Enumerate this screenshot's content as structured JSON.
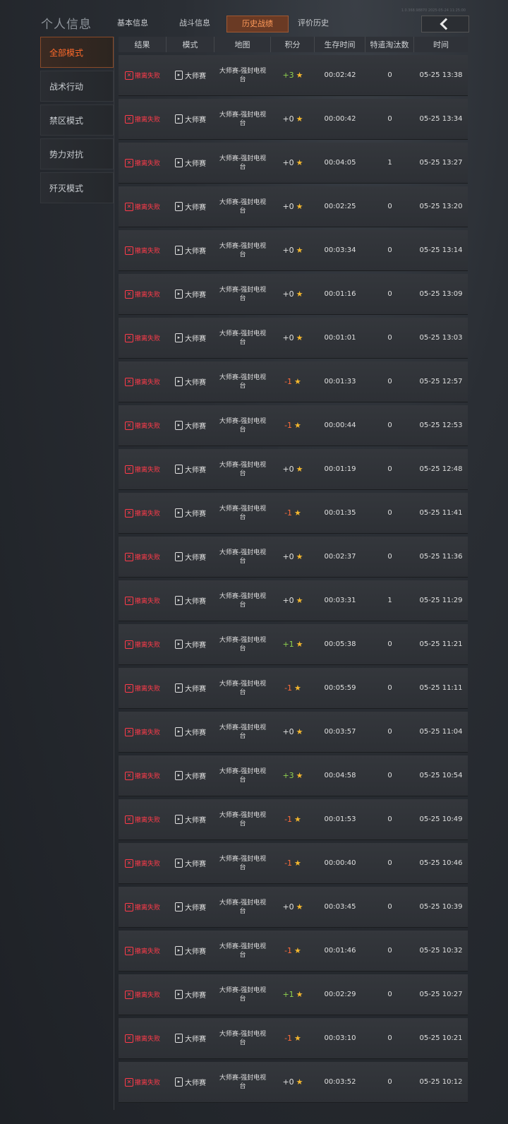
{
  "header": {
    "title": "个人信息",
    "tabs": [
      "基本信息",
      "战斗信息",
      "历史战绩",
      "评价历史"
    ],
    "active_tab": 2,
    "version": "1.0.368.98870 2025-05-24 11:25:00"
  },
  "sidebar": {
    "items": [
      "全部模式",
      "战术行动",
      "禁区模式",
      "势力对抗",
      "歼灭模式"
    ],
    "active": 0
  },
  "table": {
    "headers": [
      "结果",
      "模式",
      "地图",
      "积分",
      "生存时间",
      "特遣淘汰数",
      "时间"
    ],
    "rows": [
      {
        "result": "撤离失败",
        "mode": "大师赛",
        "map": "大师赛-强封电视台",
        "score": "+3",
        "survive": "00:02:42",
        "kills": "0",
        "time": "05-25 13:38"
      },
      {
        "result": "撤离失败",
        "mode": "大师赛",
        "map": "大师赛-强封电视台",
        "score": "+0",
        "survive": "00:00:42",
        "kills": "0",
        "time": "05-25 13:34"
      },
      {
        "result": "撤离失败",
        "mode": "大师赛",
        "map": "大师赛-强封电视台",
        "score": "+0",
        "survive": "00:04:05",
        "kills": "1",
        "time": "05-25 13:27"
      },
      {
        "result": "撤离失败",
        "mode": "大师赛",
        "map": "大师赛-强封电视台",
        "score": "+0",
        "survive": "00:02:25",
        "kills": "0",
        "time": "05-25 13:20"
      },
      {
        "result": "撤离失败",
        "mode": "大师赛",
        "map": "大师赛-强封电视台",
        "score": "+0",
        "survive": "00:03:34",
        "kills": "0",
        "time": "05-25 13:14"
      },
      {
        "result": "撤离失败",
        "mode": "大师赛",
        "map": "大师赛-强封电视台",
        "score": "+0",
        "survive": "00:01:16",
        "kills": "0",
        "time": "05-25 13:09"
      },
      {
        "result": "撤离失败",
        "mode": "大师赛",
        "map": "大师赛-强封电视台",
        "score": "+0",
        "survive": "00:01:01",
        "kills": "0",
        "time": "05-25 13:03"
      },
      {
        "result": "撤离失败",
        "mode": "大师赛",
        "map": "大师赛-强封电视台",
        "score": "-1",
        "survive": "00:01:33",
        "kills": "0",
        "time": "05-25 12:57"
      },
      {
        "result": "撤离失败",
        "mode": "大师赛",
        "map": "大师赛-强封电视台",
        "score": "-1",
        "survive": "00:00:44",
        "kills": "0",
        "time": "05-25 12:53"
      },
      {
        "result": "撤离失败",
        "mode": "大师赛",
        "map": "大师赛-强封电视台",
        "score": "+0",
        "survive": "00:01:19",
        "kills": "0",
        "time": "05-25 12:48"
      },
      {
        "result": "撤离失败",
        "mode": "大师赛",
        "map": "大师赛-强封电视台",
        "score": "-1",
        "survive": "00:01:35",
        "kills": "0",
        "time": "05-25 11:41"
      },
      {
        "result": "撤离失败",
        "mode": "大师赛",
        "map": "大师赛-强封电视台",
        "score": "+0",
        "survive": "00:02:37",
        "kills": "0",
        "time": "05-25 11:36"
      },
      {
        "result": "撤离失败",
        "mode": "大师赛",
        "map": "大师赛-强封电视台",
        "score": "+0",
        "survive": "00:03:31",
        "kills": "1",
        "time": "05-25 11:29"
      },
      {
        "result": "撤离失败",
        "mode": "大师赛",
        "map": "大师赛-强封电视台",
        "score": "+1",
        "survive": "00:05:38",
        "kills": "0",
        "time": "05-25 11:21"
      },
      {
        "result": "撤离失败",
        "mode": "大师赛",
        "map": "大师赛-强封电视台",
        "score": "-1",
        "survive": "00:05:59",
        "kills": "0",
        "time": "05-25 11:11"
      },
      {
        "result": "撤离失败",
        "mode": "大师赛",
        "map": "大师赛-强封电视台",
        "score": "+0",
        "survive": "00:03:57",
        "kills": "0",
        "time": "05-25 11:04"
      },
      {
        "result": "撤离失败",
        "mode": "大师赛",
        "map": "大师赛-强封电视台",
        "score": "+3",
        "survive": "00:04:58",
        "kills": "0",
        "time": "05-25 10:54"
      },
      {
        "result": "撤离失败",
        "mode": "大师赛",
        "map": "大师赛-强封电视台",
        "score": "-1",
        "survive": "00:01:53",
        "kills": "0",
        "time": "05-25 10:49"
      },
      {
        "result": "撤离失败",
        "mode": "大师赛",
        "map": "大师赛-强封电视台",
        "score": "-1",
        "survive": "00:00:40",
        "kills": "0",
        "time": "05-25 10:46"
      },
      {
        "result": "撤离失败",
        "mode": "大师赛",
        "map": "大师赛-强封电视台",
        "score": "+0",
        "survive": "00:03:45",
        "kills": "0",
        "time": "05-25 10:39"
      },
      {
        "result": "撤离失败",
        "mode": "大师赛",
        "map": "大师赛-强封电视台",
        "score": "-1",
        "survive": "00:01:46",
        "kills": "0",
        "time": "05-25 10:32"
      },
      {
        "result": "撤离失败",
        "mode": "大师赛",
        "map": "大师赛-强封电视台",
        "score": "+1",
        "survive": "00:02:29",
        "kills": "0",
        "time": "05-25 10:27"
      },
      {
        "result": "撤离失败",
        "mode": "大师赛",
        "map": "大师赛-强封电视台",
        "score": "-1",
        "survive": "00:03:10",
        "kills": "0",
        "time": "05-25 10:21"
      },
      {
        "result": "撤离失败",
        "mode": "大师赛",
        "map": "大师赛-强封电视台",
        "score": "+0",
        "survive": "00:03:52",
        "kills": "0",
        "time": "05-25 10:12"
      }
    ]
  },
  "colors": {
    "accent": "#ff6a2a",
    "fail": "#ff3b4a",
    "plus": "#8fd14f",
    "minus": "#ff6b3a",
    "star": "#f5b82e"
  },
  "icons": {
    "result": "fail-x-icon",
    "mode": "tournament-icon",
    "score": "star-icon",
    "back": "back-arrow-icon"
  }
}
